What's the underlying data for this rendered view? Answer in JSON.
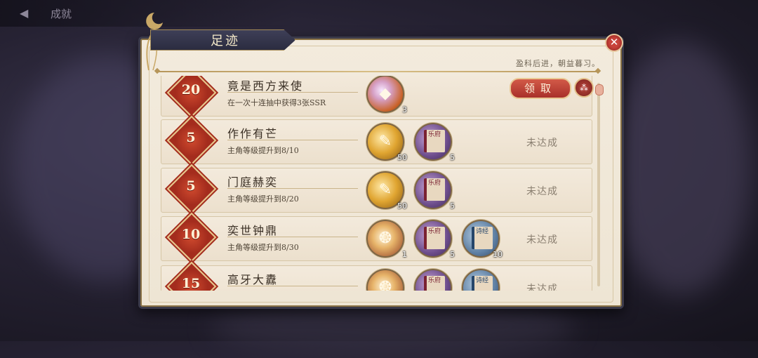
{
  "topbar": {
    "title": "成就"
  },
  "panel": {
    "title": "足迹",
    "motto": "盈科后进，朝益暮习。",
    "close_icon": "✕"
  },
  "colors": {
    "accent_red": "#a9302a",
    "gold": "#b6955a",
    "panel_bg": "#f3ebdd"
  },
  "achievements": [
    {
      "badge": "20",
      "title": "竟是西方来使",
      "desc": "在一次十连抽中获得3张SSR",
      "rewards": [
        {
          "icon": "gem-icon",
          "count": "3"
        }
      ],
      "claim_label": "领取",
      "share_icon": "share-icon"
    },
    {
      "badge": "5",
      "title": "作作有芒",
      "desc": "主角等级提升到8/10",
      "rewards": [
        {
          "icon": "feather-icon",
          "count": "50"
        },
        {
          "icon": "book-yuefu-icon",
          "label": "乐府",
          "count": "5"
        }
      ],
      "status": "未达成"
    },
    {
      "badge": "5",
      "title": "门庭赫奕",
      "desc": "主角等级提升到8/20",
      "rewards": [
        {
          "icon": "feather-icon",
          "count": "50"
        },
        {
          "icon": "book-yuefu-icon",
          "label": "乐府",
          "count": "5"
        }
      ],
      "status": "未达成"
    },
    {
      "badge": "10",
      "title": "奕世钟鼎",
      "desc": "主角等级提升到8/30",
      "rewards": [
        {
          "icon": "ring-icon",
          "count": "1"
        },
        {
          "icon": "book-yuefu-icon",
          "label": "乐府",
          "count": "5"
        },
        {
          "icon": "book-shijing-icon",
          "label": "诗经",
          "count": "10"
        }
      ],
      "status": "未达成"
    },
    {
      "badge": "15",
      "title": "高牙大纛",
      "rewards": [
        {
          "icon": "ring-icon"
        },
        {
          "icon": "book-yuefu-icon",
          "label": "乐府"
        },
        {
          "icon": "book-shijing-icon",
          "label": "诗经"
        }
      ],
      "status": "未达成"
    }
  ]
}
